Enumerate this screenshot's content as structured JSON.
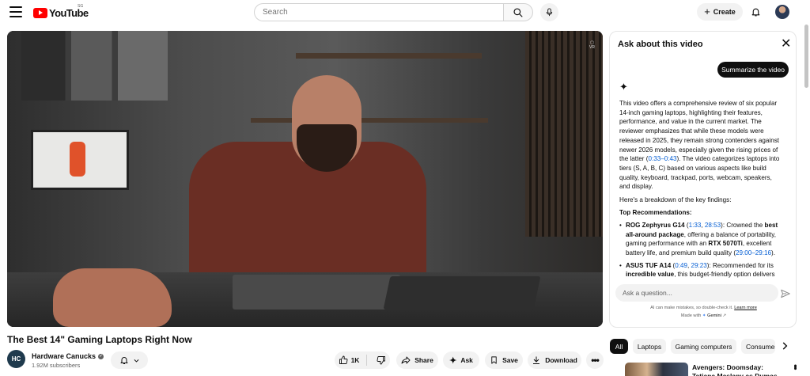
{
  "header": {
    "logo_text": "YouTube",
    "logo_region": "SG",
    "search_placeholder": "Search",
    "create_label": "Create"
  },
  "player": {
    "vr_badge": "VR"
  },
  "ask_panel": {
    "title": "Ask about this video",
    "summarize_label": "Summarize the video",
    "gem_glyph": "✦",
    "summary": {
      "p1_a": "This video offers a comprehensive review of six popular 14-inch gaming laptops, highlighting their features, performance, and value in the current market. The reviewer emphasizes that while these models were released in 2025, they remain strong contenders against newer 2026 models, especially given the rising prices of the latter (",
      "p1_ts": "0:33–0:43",
      "p1_b": "). The video categorizes laptops into tiers (S, A, B, C) based on various aspects like build quality, keyboard, trackpad, ports, webcam, speakers, and display.",
      "p2": "Here's a breakdown of the key findings:",
      "heading": "Top Recommendations:",
      "items": [
        {
          "name": "ROG Zephyrus G14",
          "ts1": "1:33",
          "ts2": "28:53",
          "text_a": ": Crowned the ",
          "bold_a": "best all-around package",
          "text_b": ", offering a balance of portability, gaming performance with an ",
          "bold_b": "RTX 5070Ti",
          "text_c": ", excellent battery life, and premium build quality (",
          "ts3": "29:00–29:16",
          "text_d": ")."
        },
        {
          "name": "ASUS TUF A14",
          "ts1": "0:49",
          "ts2": "29:23",
          "text_a": ": Recommended for its ",
          "bold_a": "incredible value",
          "text_b": ", this budget-friendly option delivers"
        }
      ]
    },
    "input_placeholder": "Ask a question...",
    "disclaimer": "AI can make mistakes, so double-check it.",
    "learn_more": "Learn more",
    "made_with": "Made with",
    "gemini": "Gemini"
  },
  "video": {
    "title": "The Best 14\" Gaming Laptops Right Now",
    "channel_name": "Hardware Canucks",
    "channel_initials": "HC",
    "subscribers": "1.92M subscribers",
    "like_count": "1K",
    "share_label": "Share",
    "ask_label": "Ask",
    "save_label": "Save",
    "download_label": "Download"
  },
  "chips": [
    "All",
    "Laptops",
    "Gaming computers",
    "Consumer"
  ],
  "recommended": {
    "title": "Avengers: Doomsday: Tatiana Maslany as Dumas Che"
  }
}
